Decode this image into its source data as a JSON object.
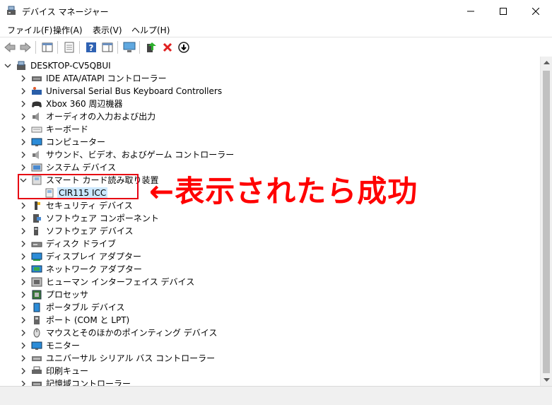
{
  "window": {
    "title": "デバイス マネージャー"
  },
  "menu": [
    "ファイル(F)",
    "操作(A)",
    "表示(V)",
    "ヘルプ(H)"
  ],
  "toolbar_icons": [
    "back-arrow-icon",
    "forward-arrow-icon",
    "show-hide-console-tree-icon",
    "properties-icon",
    "help-icon",
    "action-pane-icon",
    "monitor-icon",
    "update-driver-icon",
    "uninstall-icon",
    "disable-device-icon"
  ],
  "tree": {
    "root": "DESKTOP-CV5QBUI",
    "items": [
      {
        "label": "IDE ATA/ATAPI コントローラー",
        "icon": "ide-controller-icon"
      },
      {
        "label": "Universal Serial Bus Keyboard Controllers",
        "icon": "keyboard-controller-icon"
      },
      {
        "label": "Xbox 360 周辺機器",
        "icon": "gamepad-icon"
      },
      {
        "label": "オーディオの入力および出力",
        "icon": "speaker-icon"
      },
      {
        "label": "キーボード",
        "icon": "keyboard-icon"
      },
      {
        "label": "コンピューター",
        "icon": "computer-icon"
      },
      {
        "label": "サウンド、ビデオ、およびゲーム コントローラー",
        "icon": "sound-icon"
      },
      {
        "label": "システム デバイス",
        "icon": "system-device-icon"
      },
      {
        "label": "スマート カード読み取り装置",
        "icon": "smart-card-reader-icon",
        "expanded": true,
        "children": [
          {
            "label": "CIR115 ICC",
            "icon": "smart-card-device-icon",
            "selected": true
          }
        ]
      },
      {
        "label": "セキュリティ デバイス",
        "icon": "security-device-icon"
      },
      {
        "label": "ソフトウェア コンポーネント",
        "icon": "software-component-icon"
      },
      {
        "label": "ソフトウェア デバイス",
        "icon": "software-device-icon"
      },
      {
        "label": "ディスク ドライブ",
        "icon": "disk-drive-icon"
      },
      {
        "label": "ディスプレイ アダプター",
        "icon": "display-adapter-icon"
      },
      {
        "label": "ネットワーク アダプター",
        "icon": "network-adapter-icon"
      },
      {
        "label": "ヒューマン インターフェイス デバイス",
        "icon": "hid-icon"
      },
      {
        "label": "プロセッサ",
        "icon": "processor-icon"
      },
      {
        "label": "ポータブル デバイス",
        "icon": "portable-device-icon"
      },
      {
        "label": "ポート (COM と LPT)",
        "icon": "port-icon"
      },
      {
        "label": "マウスとそのほかのポインティング デバイス",
        "icon": "mouse-icon"
      },
      {
        "label": "モニター",
        "icon": "monitor-icon"
      },
      {
        "label": "ユニバーサル シリアル バス コントローラー",
        "icon": "usb-icon"
      },
      {
        "label": "印刷キュー",
        "icon": "printer-icon"
      },
      {
        "label": "記憶域コントローラー",
        "icon": "storage-controller-icon"
      }
    ]
  },
  "annotation": {
    "text": "←表示されたら成功",
    "color": "#ff0000"
  }
}
